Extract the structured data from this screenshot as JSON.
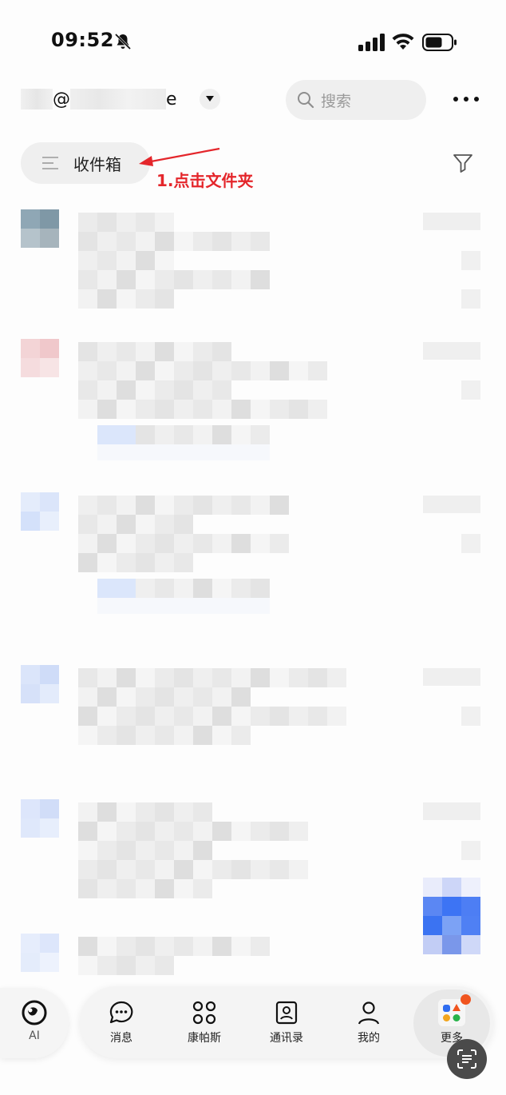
{
  "status_bar": {
    "time": "09:52",
    "icons": [
      "bell-muted-icon",
      "signal-icon",
      "wifi-icon",
      "battery-icon"
    ]
  },
  "header": {
    "account_visible_text": "@",
    "account_suffix": "e",
    "search_placeholder": "搜索"
  },
  "toolbar": {
    "folder_label": "收件箱"
  },
  "annotation": {
    "text": "1.点击文件夹",
    "color": "#e4262b"
  },
  "tabbar": {
    "items": [
      {
        "label": "AI",
        "icon": "ai-icon"
      },
      {
        "label": "消息",
        "icon": "chat-icon"
      },
      {
        "label": "康帕斯",
        "icon": "grid-icon"
      },
      {
        "label": "通讯录",
        "icon": "contacts-icon"
      },
      {
        "label": "我的",
        "icon": "person-icon"
      },
      {
        "label": "更多",
        "icon": "apps-icon"
      }
    ]
  },
  "colors": {
    "accent_red": "#e4262b",
    "badge_orange": "#f0541e",
    "pill_bg": "#efefef"
  }
}
